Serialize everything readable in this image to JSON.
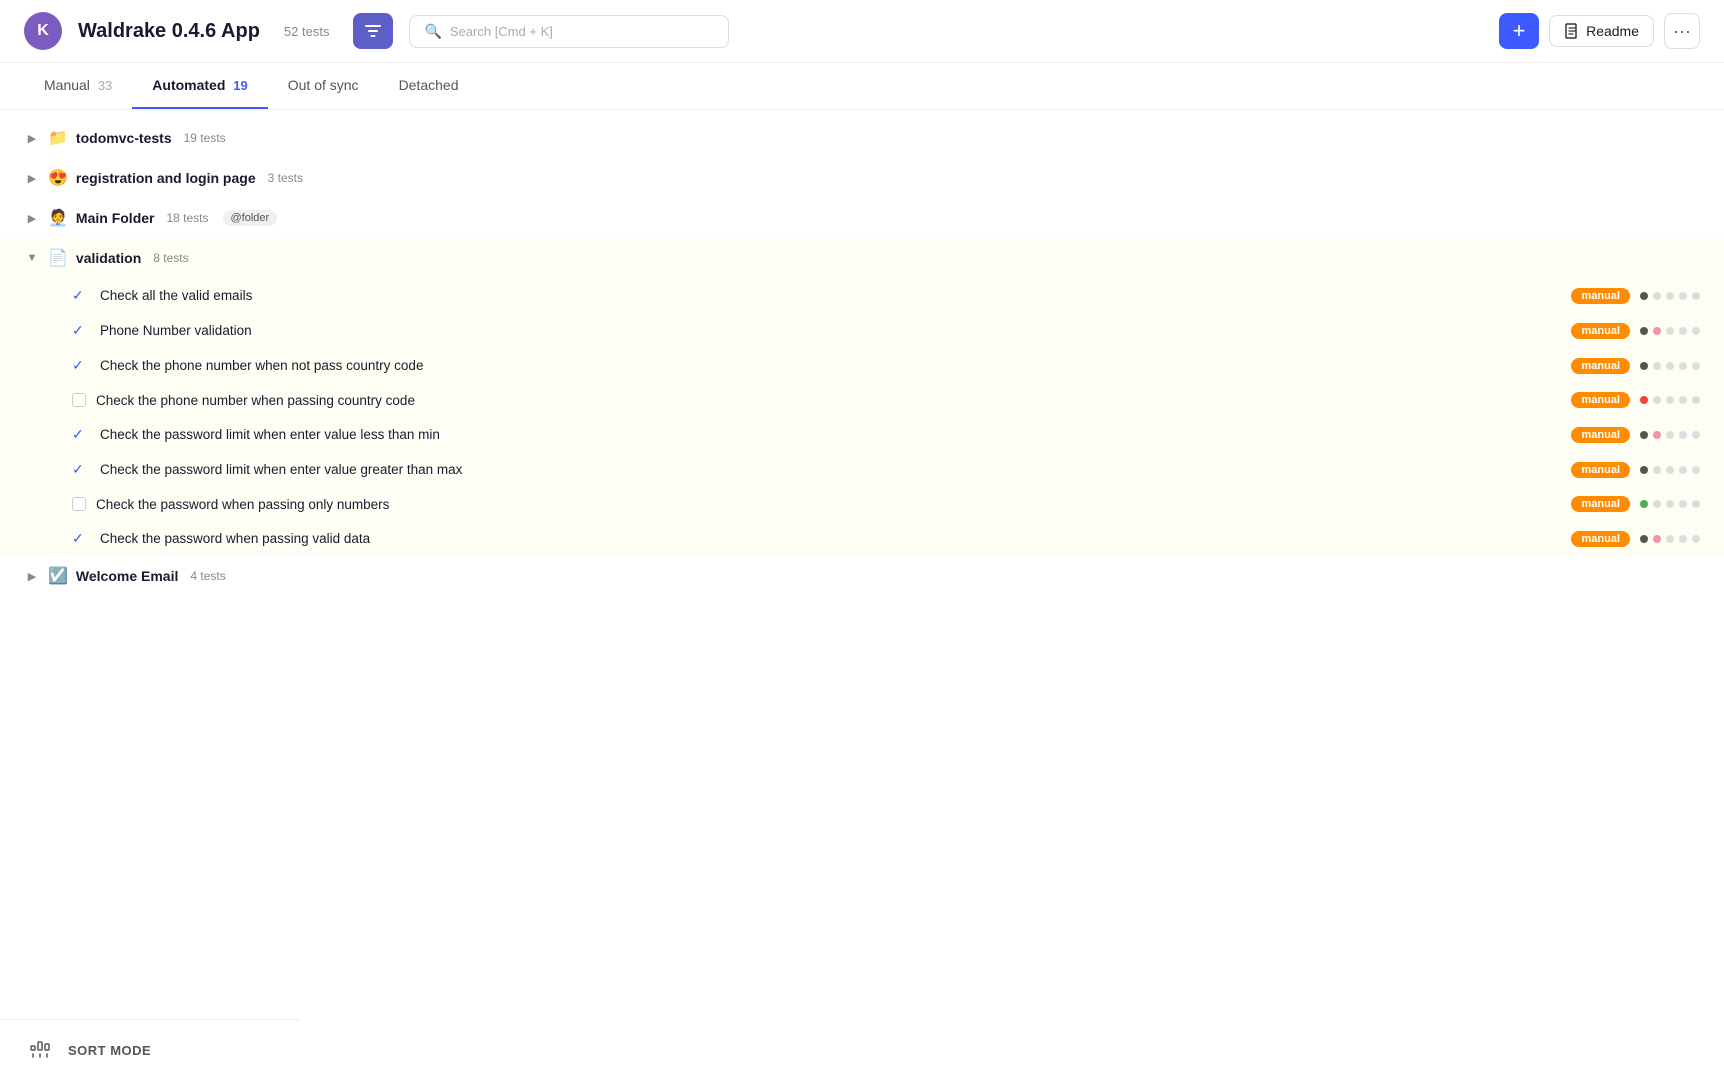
{
  "header": {
    "avatar_letter": "K",
    "app_title": "Waldrake 0.4.6 App",
    "test_count": "52 tests",
    "search_placeholder": "Search [Cmd + K]",
    "add_label": "+",
    "readme_label": "Readme",
    "more_label": "···"
  },
  "tabs": [
    {
      "id": "manual",
      "label": "Manual",
      "count": "33",
      "active": false
    },
    {
      "id": "automated",
      "label": "Automated",
      "count": "19",
      "active": true
    },
    {
      "id": "out-of-sync",
      "label": "Out of sync",
      "count": "",
      "active": false
    },
    {
      "id": "detached",
      "label": "Detached",
      "count": "",
      "active": false
    }
  ],
  "folders": [
    {
      "id": "todomvc",
      "name": "todomvc-tests",
      "count": "19 tests",
      "icon": "📁",
      "expanded": false,
      "tag": null
    },
    {
      "id": "registration",
      "name": "registration and login page",
      "count": "3 tests",
      "icon": "😍",
      "expanded": false,
      "tag": null
    },
    {
      "id": "main-folder",
      "name": "Main Folder",
      "count": "18 tests",
      "icon": "🧑‍💼",
      "expanded": false,
      "tag": "@folder"
    },
    {
      "id": "validation",
      "name": "validation",
      "count": "8 tests",
      "icon": "📄",
      "expanded": true,
      "tag": null,
      "tests": [
        {
          "id": "t1",
          "name": "Check all the valid emails",
          "status": "checked",
          "badge": "manual",
          "dots": [
            "dark",
            "light",
            "light",
            "light",
            "light"
          ]
        },
        {
          "id": "t2",
          "name": "Phone Number validation",
          "status": "checked",
          "badge": "manual",
          "dots": [
            "dark",
            "pink",
            "light",
            "light",
            "light"
          ]
        },
        {
          "id": "t3",
          "name": "Check the phone number when not pass country code",
          "status": "checked",
          "badge": "manual",
          "dots": [
            "dark",
            "light",
            "light",
            "light",
            "light"
          ]
        },
        {
          "id": "t4",
          "name": "Check the phone number when passing country code",
          "status": "unchecked",
          "badge": "manual",
          "dots": [
            "red",
            "light",
            "light",
            "light",
            "light"
          ]
        },
        {
          "id": "t5",
          "name": "Check the password limit when enter value less than min",
          "status": "checked",
          "badge": "manual",
          "dots": [
            "dark",
            "pink",
            "light",
            "light",
            "light"
          ]
        },
        {
          "id": "t6",
          "name": "Check the password limit when enter value greater than max",
          "status": "checked",
          "badge": "manual",
          "dots": [
            "dark",
            "light",
            "light",
            "light",
            "light"
          ]
        },
        {
          "id": "t7",
          "name": "Check the password when passing only numbers",
          "status": "unchecked",
          "badge": "manual",
          "dots": [
            "green",
            "light",
            "light",
            "light",
            "light"
          ]
        },
        {
          "id": "t8",
          "name": "Check the password when passing valid data",
          "status": "checked",
          "badge": "manual",
          "dots": [
            "dark",
            "pink",
            "light",
            "light",
            "light"
          ]
        }
      ]
    },
    {
      "id": "welcome-email",
      "name": "Welcome Email",
      "count": "4 tests",
      "icon": "☑️",
      "expanded": false,
      "tag": null
    }
  ],
  "sort_mode": {
    "label": "SORT MODE",
    "icon": "⌘"
  }
}
